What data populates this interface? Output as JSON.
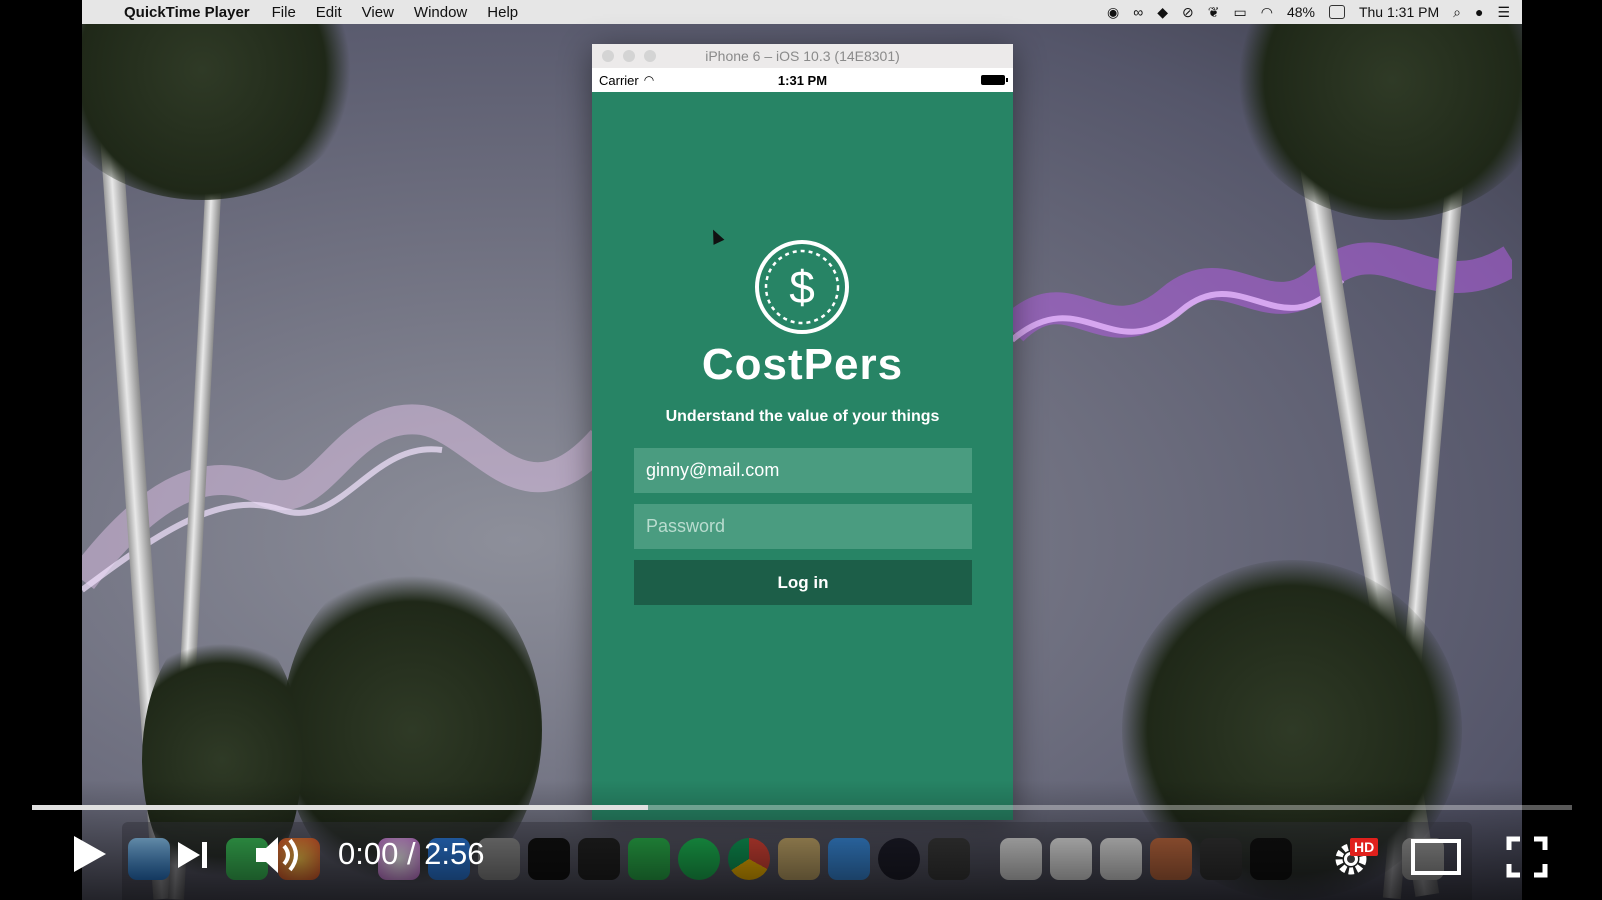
{
  "menubar": {
    "app_name": "QuickTime Player",
    "menus": [
      "File",
      "Edit",
      "View",
      "Window",
      "Help"
    ],
    "battery": "48%",
    "clock": "Thu 1:31 PM"
  },
  "simulator": {
    "window_title": "iPhone 6 – iOS 10.3 (14E8301)",
    "status_carrier": "Carrier",
    "status_time": "1:31 PM"
  },
  "app": {
    "name": "CostPers",
    "tagline": "Understand the value of your things",
    "email_value": "ginny@mail.com",
    "password_placeholder": "Password",
    "login_label": "Log in",
    "logo_symbol": "$"
  },
  "player": {
    "time_display": "0:00 / 2:56",
    "progress": 0.4,
    "hd_badge": "HD"
  },
  "colors": {
    "app_green": "#278465",
    "field_green": "#4a9c80",
    "button_green": "#1c5e48"
  }
}
